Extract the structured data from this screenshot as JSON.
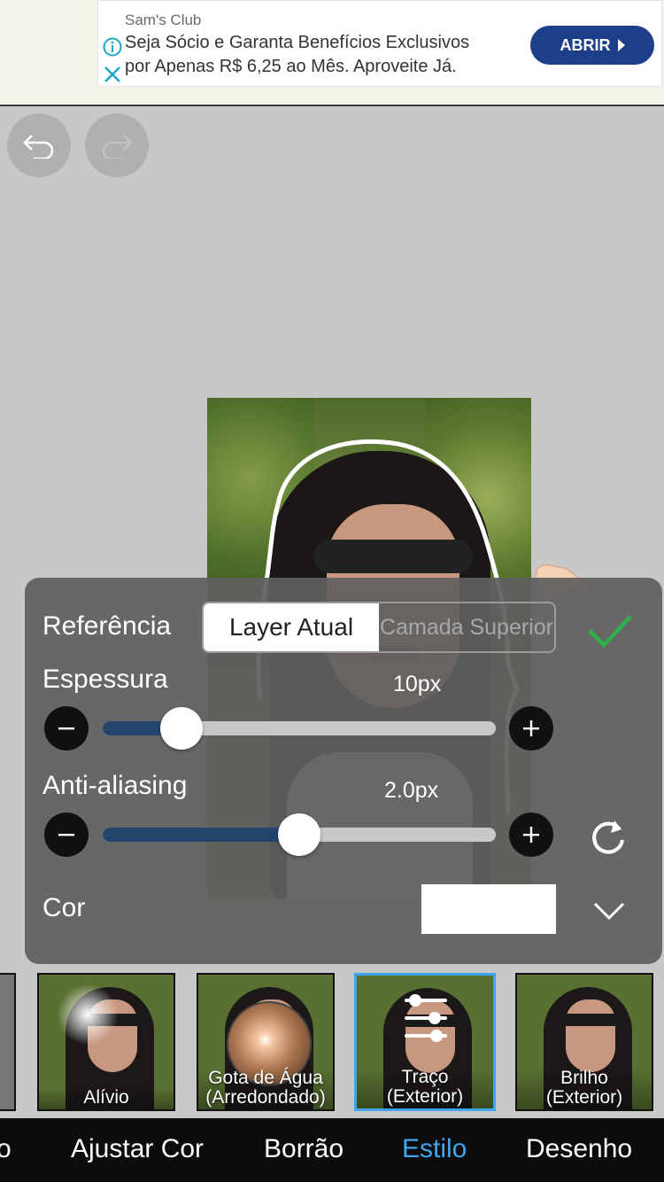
{
  "ad": {
    "sponsor": "Sam's Club",
    "line1": "Seja Sócio e Garanta Benefícios Exclusivos",
    "line2": "por Apenas R$ 6,25 ao Mês. Aproveite Já.",
    "cta": "ABRIR",
    "brand_color": "#1d3f8a"
  },
  "toolbar": {
    "undo_icon": "undo-icon",
    "redo_icon": "redo-icon"
  },
  "panel": {
    "reference_label": "Referência",
    "reference_options": [
      "Layer Atual",
      "Camada Superior"
    ],
    "reference_selected": "Layer Atual",
    "thickness_label": "Espessura",
    "thickness_value": "10px",
    "thickness_level": 0.2,
    "antialias_label": "Anti-aliasing",
    "antialias_value": "2.0px",
    "antialias_level": 0.5,
    "color_label": "Cor",
    "color_value": "#ffffff"
  },
  "effects": [
    {
      "label1": "Alívio",
      "label2": ""
    },
    {
      "label1": "Gota de Água",
      "label2": "(Arredondado)"
    },
    {
      "label1": "Traço",
      "label2": "(Exterior)"
    },
    {
      "label1": "Brilho",
      "label2": "(Exterior)"
    }
  ],
  "tabs": [
    "o",
    "Ajustar Cor",
    "Borrão",
    "Estilo",
    "Desenho"
  ],
  "active_tab": "Estilo",
  "accent_color": "#3ea6f0"
}
